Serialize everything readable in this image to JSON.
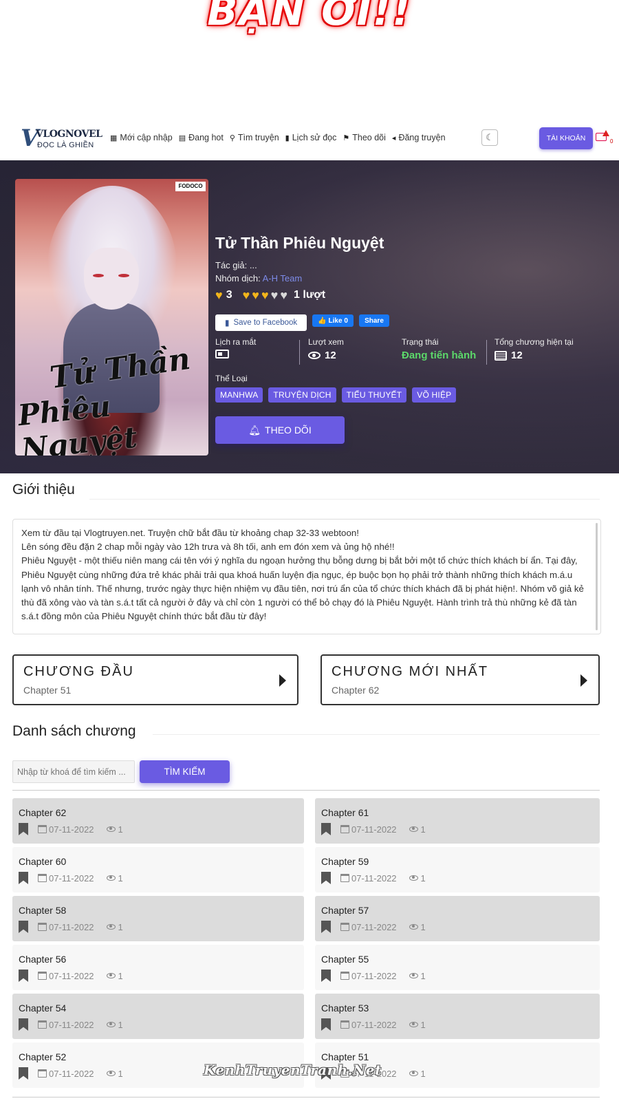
{
  "banner": {
    "text": "BẠN ƠI!!"
  },
  "logo": {
    "mark": "V",
    "name": "VLOGNOVEL",
    "tagline": "ĐỌC LÀ GHIỀN"
  },
  "nav": {
    "items": [
      {
        "icon": "grid-icon",
        "glyph": "▦",
        "label": "Mới cập nhập"
      },
      {
        "icon": "hot-list-icon",
        "glyph": "▤",
        "label": "Đang hot"
      },
      {
        "icon": "search-icon",
        "glyph": "⚲",
        "label": "Tìm truyện"
      },
      {
        "icon": "book-icon",
        "glyph": "▮",
        "label": "Lịch sử đọc"
      },
      {
        "icon": "bookmark-icon",
        "glyph": "⚑",
        "label": "Theo dõi"
      },
      {
        "icon": "megaphone-icon",
        "glyph": "◂",
        "label": "Đăng truyện"
      }
    ],
    "theme_glyph": "☾",
    "account_label": "TÀI KHOẢN",
    "notification_count": "0"
  },
  "story": {
    "cover_badge": "FODOCO",
    "cover_title_line1": "Tử Thần",
    "cover_title_line2": "Phiêu Nguyệt",
    "title": "Tử Thần Phiêu Nguyệt",
    "author_label": "Tác giả:",
    "author_value": "...",
    "group_label": "Nhóm dịch:",
    "group_value": "A-H Team",
    "rating_value": "3",
    "rating_hearts_filled": 3,
    "rating_hearts_total": 5,
    "rating_count": "1 lượt",
    "save_fb_label": "Save to Facebook",
    "like_label": "Like 0",
    "share_label": "Share",
    "stats": {
      "release_label": "Lịch ra mắt",
      "views_label": "Lượt xem",
      "views_value": "12",
      "status_label": "Trạng thái",
      "status_value": "Đang tiến hành",
      "chapters_label": "Tổng chương hiện tại",
      "chapters_value": "12"
    },
    "genre_label": "Thể Loại",
    "genres": [
      "MANHWA",
      "TRUYỆN DỊCH",
      "TIỂU THUYẾT",
      "VÕ HIỆP"
    ],
    "follow_label": "THEO DÕI"
  },
  "intro": {
    "title": "Giới thiệu",
    "lines": [
      "Xem từ đầu tại Vlogtruyen.net. Truyện chữ bắt đầu từ khoảng chap 32-33 webtoon!",
      "Lên sóng đều đặn 2 chap mỗi ngày vào 12h trưa và 8h tối, anh em đón xem và ủng hộ nhé!!",
      "Phiêu Nguyệt - một thiếu niên mang cái tên với ý nghĩa du ngoạn hưởng thụ bỗng dưng bị bắt bởi một tổ chức thích khách bí ẩn. Tại đây, Phiêu Nguyệt cùng những đứa trẻ khác phải trải qua khoá huấn luyện địa ngục, ép buộc bọn họ phải trở thành những thích khách m.á.u lạnh vô nhân tính. Thế nhưng, trước ngày thực hiện nhiệm vụ đầu tiên, nơi trú ẩn của tổ chức thích khách đã bị phát hiện!. Nhóm võ giả kẻ thù đã xông vào và tàn s.á.t tất cả người ở đây và chỉ còn 1 người có thể bỏ chạy đó là Phiêu Nguyệt. Hành trình trả thù những kẻ đã tàn s.á.t đồng môn của Phiêu Nguyệt chính thức bắt đầu từ đây!"
    ]
  },
  "first_chapter": {
    "title": "CHƯƠNG ĐẦU",
    "sub": "Chapter 51"
  },
  "latest_chapter": {
    "title": "CHƯƠNG MỚI NHẤT",
    "sub": "Chapter 62"
  },
  "chapter_list": {
    "title": "Danh sách chương",
    "search_placeholder": "Nhập từ khoá để tìm kiếm ...",
    "search_button": "TÌM KIẾM",
    "items": [
      {
        "name": "Chapter 62",
        "date": "07-11-2022",
        "views": "1"
      },
      {
        "name": "Chapter 61",
        "date": "07-11-2022",
        "views": "1"
      },
      {
        "name": "Chapter 60",
        "date": "07-11-2022",
        "views": "1"
      },
      {
        "name": "Chapter 59",
        "date": "07-11-2022",
        "views": "1"
      },
      {
        "name": "Chapter 58",
        "date": "07-11-2022",
        "views": "1"
      },
      {
        "name": "Chapter 57",
        "date": "07-11-2022",
        "views": "1"
      },
      {
        "name": "Chapter 56",
        "date": "07-11-2022",
        "views": "1"
      },
      {
        "name": "Chapter 55",
        "date": "07-11-2022",
        "views": "1"
      },
      {
        "name": "Chapter 54",
        "date": "07-11-2022",
        "views": "1"
      },
      {
        "name": "Chapter 53",
        "date": "07-11-2022",
        "views": "1"
      },
      {
        "name": "Chapter 52",
        "date": "07-11-2022",
        "views": "1"
      },
      {
        "name": "Chapter 51",
        "date": "07-11-2022",
        "views": "1"
      }
    ]
  },
  "watermark": "KenhTruyenTranh.Net",
  "colors": {
    "accent": "#6a5be2",
    "status_green": "#5cd86a",
    "heart_gold": "#f2b51c",
    "link_purple": "#7d8be8"
  }
}
